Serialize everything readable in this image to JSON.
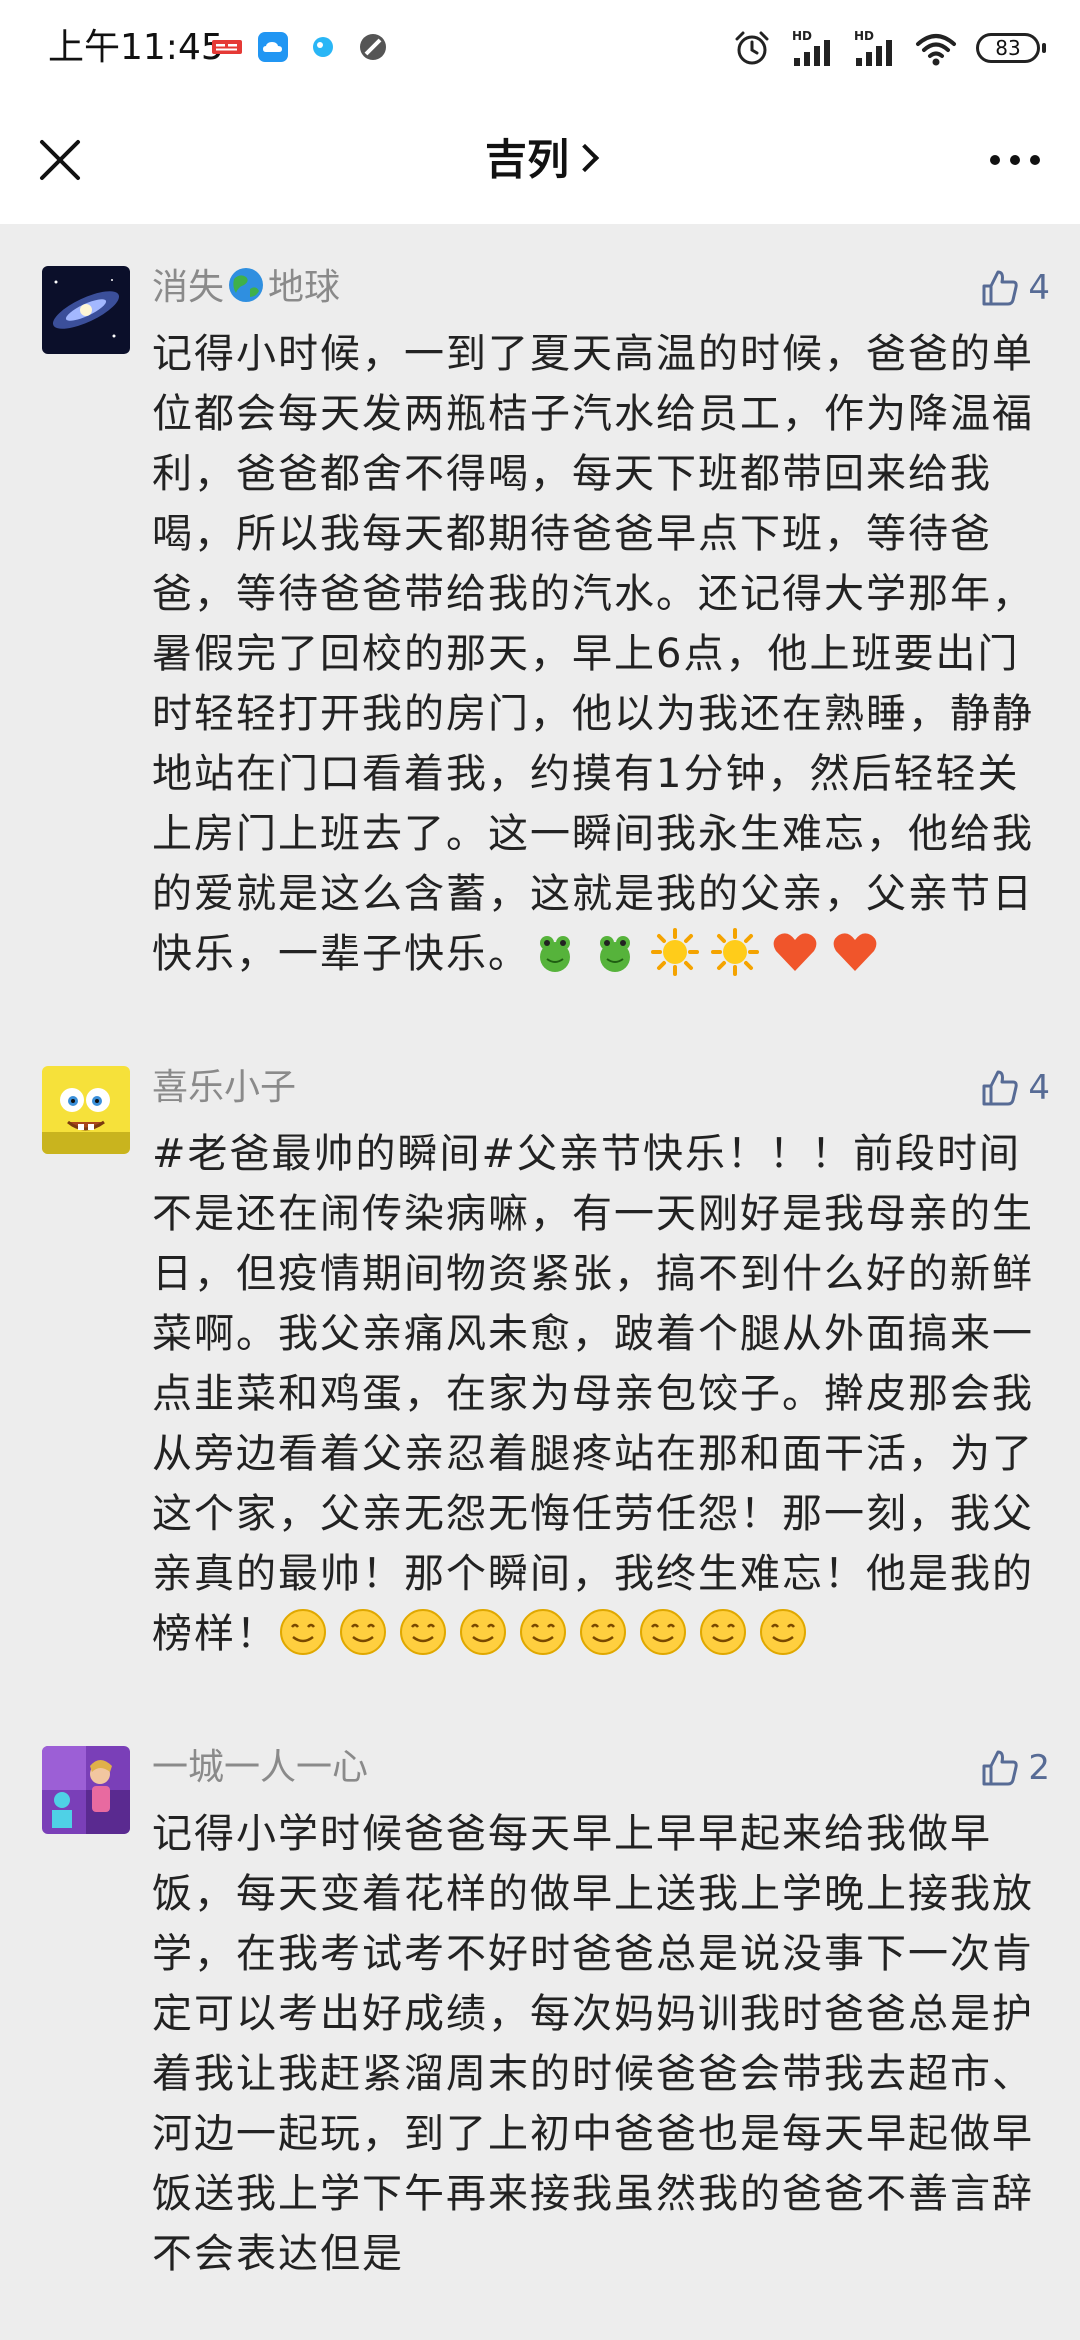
{
  "status_bar": {
    "time": "上午11:45",
    "battery": "83"
  },
  "header": {
    "title": "吉列",
    "close_icon": "close-icon",
    "more_icon": "more-icon"
  },
  "colors": {
    "like_blue": "#576b95",
    "background": "#ededed"
  },
  "comments": [
    {
      "username_prefix": "消失",
      "username_suffix": "地球",
      "username_emoji": "earth-emoji",
      "likes": "4",
      "text": "记得小时候，一到了夏天高温的时候，爸爸的单位都会每天发两瓶桔子汽水给员工，作为降温福利，爸爸都舍不得喝，每天下班都带回来给我喝，所以我每天都期待爸爸早点下班，等待爸爸，等待爸爸带给我的汽水。还记得大学那年，暑假完了回校的那天，早上6点，他上班要出门时轻轻打开我的房门，他以为我还在熟睡，静静地站在门口看着我，约摸有1分钟，然后轻轻关上房门上班去了。这一瞬间我永生难忘，他给我的爱就是这么含蓄，这就是我的父亲，父亲节日快乐，一辈子快乐。",
      "emojis": [
        "frog-emoji",
        "frog-emoji",
        "sun-emoji",
        "sun-emoji",
        "heart-emoji",
        "heart-emoji"
      ]
    },
    {
      "username": "喜乐小子",
      "likes": "4",
      "text": "#老爸最帅的瞬间#父亲节快乐！！！前段时间不是还在闹传染病嘛，有一天刚好是我母亲的生日，但疫情期间物资紧张，搞不到什么好的新鲜菜啊。我父亲痛风未愈，跛着个腿从外面搞来一点韭菜和鸡蛋，在家为母亲包饺子。擀皮那会我从旁边看着父亲忍着腿疼站在那和面干活，为了这个家，父亲无怨无悔任劳任怨！那一刻，我父亲真的最帅！那个瞬间，我终生难忘！他是我的榜样！",
      "emojis": [
        "smile-emoji",
        "smile-emoji",
        "smile-emoji",
        "smile-emoji",
        "smile-emoji",
        "smile-emoji",
        "smile-emoji",
        "smile-emoji",
        "smile-emoji"
      ]
    },
    {
      "username": "一城一人一心",
      "likes": "2",
      "text": "记得小学时候爸爸每天早上早早起来给我做早饭，每天变着花样的做早上送我上学晚上接我放学，在我考试考不好时爸爸总是说没事下一次肯定可以考出好成绩，每次妈妈训我时爸爸总是护着我让我赶紧溜周末的时候爸爸会带我去超市、河边一起玩，到了上初中爸爸也是每天早起做早饭送我上学下午再来接我虽然我的爸爸不善言辞不会表达但是"
    }
  ]
}
